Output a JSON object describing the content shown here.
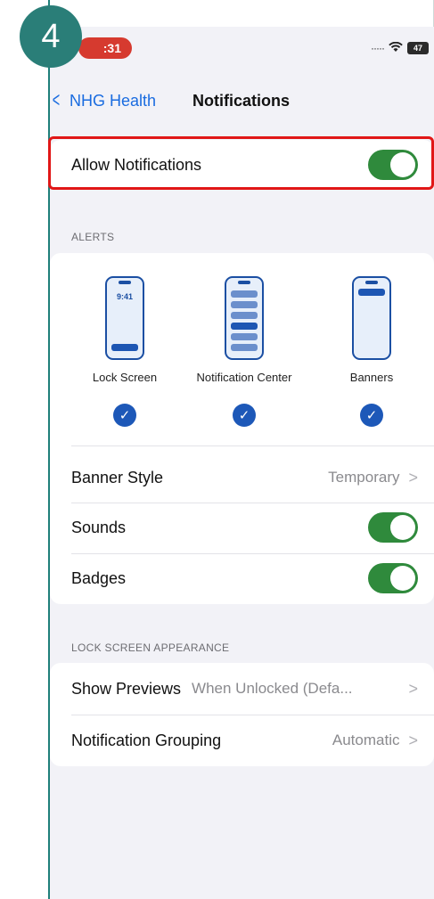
{
  "step_number": "4",
  "status_bar": {
    "time": ":31",
    "battery": "47"
  },
  "nav": {
    "back_label": "NHG Health",
    "title": "Notifications"
  },
  "allow_notifications": {
    "label": "Allow Notifications",
    "enabled": true
  },
  "alerts": {
    "section_label": "ALERTS",
    "styles": [
      {
        "label": "Lock Screen",
        "checked": true,
        "mock_time": "9:41"
      },
      {
        "label": "Notification Center",
        "checked": true
      },
      {
        "label": "Banners",
        "checked": true
      }
    ],
    "banner_style": {
      "label": "Banner Style",
      "value": "Temporary"
    },
    "sounds": {
      "label": "Sounds",
      "enabled": true
    },
    "badges": {
      "label": "Badges",
      "enabled": true
    }
  },
  "lock_screen": {
    "section_label": "LOCK SCREEN APPEARANCE",
    "show_previews": {
      "label": "Show Previews",
      "value": "When Unlocked (Defa..."
    },
    "notification_grouping": {
      "label": "Notification Grouping",
      "value": "Automatic"
    }
  },
  "colors": {
    "toggle_on": "#2f8a3c",
    "accent": "#1a6ce0",
    "highlight": "#e11717",
    "badge": "#2a7e78"
  }
}
